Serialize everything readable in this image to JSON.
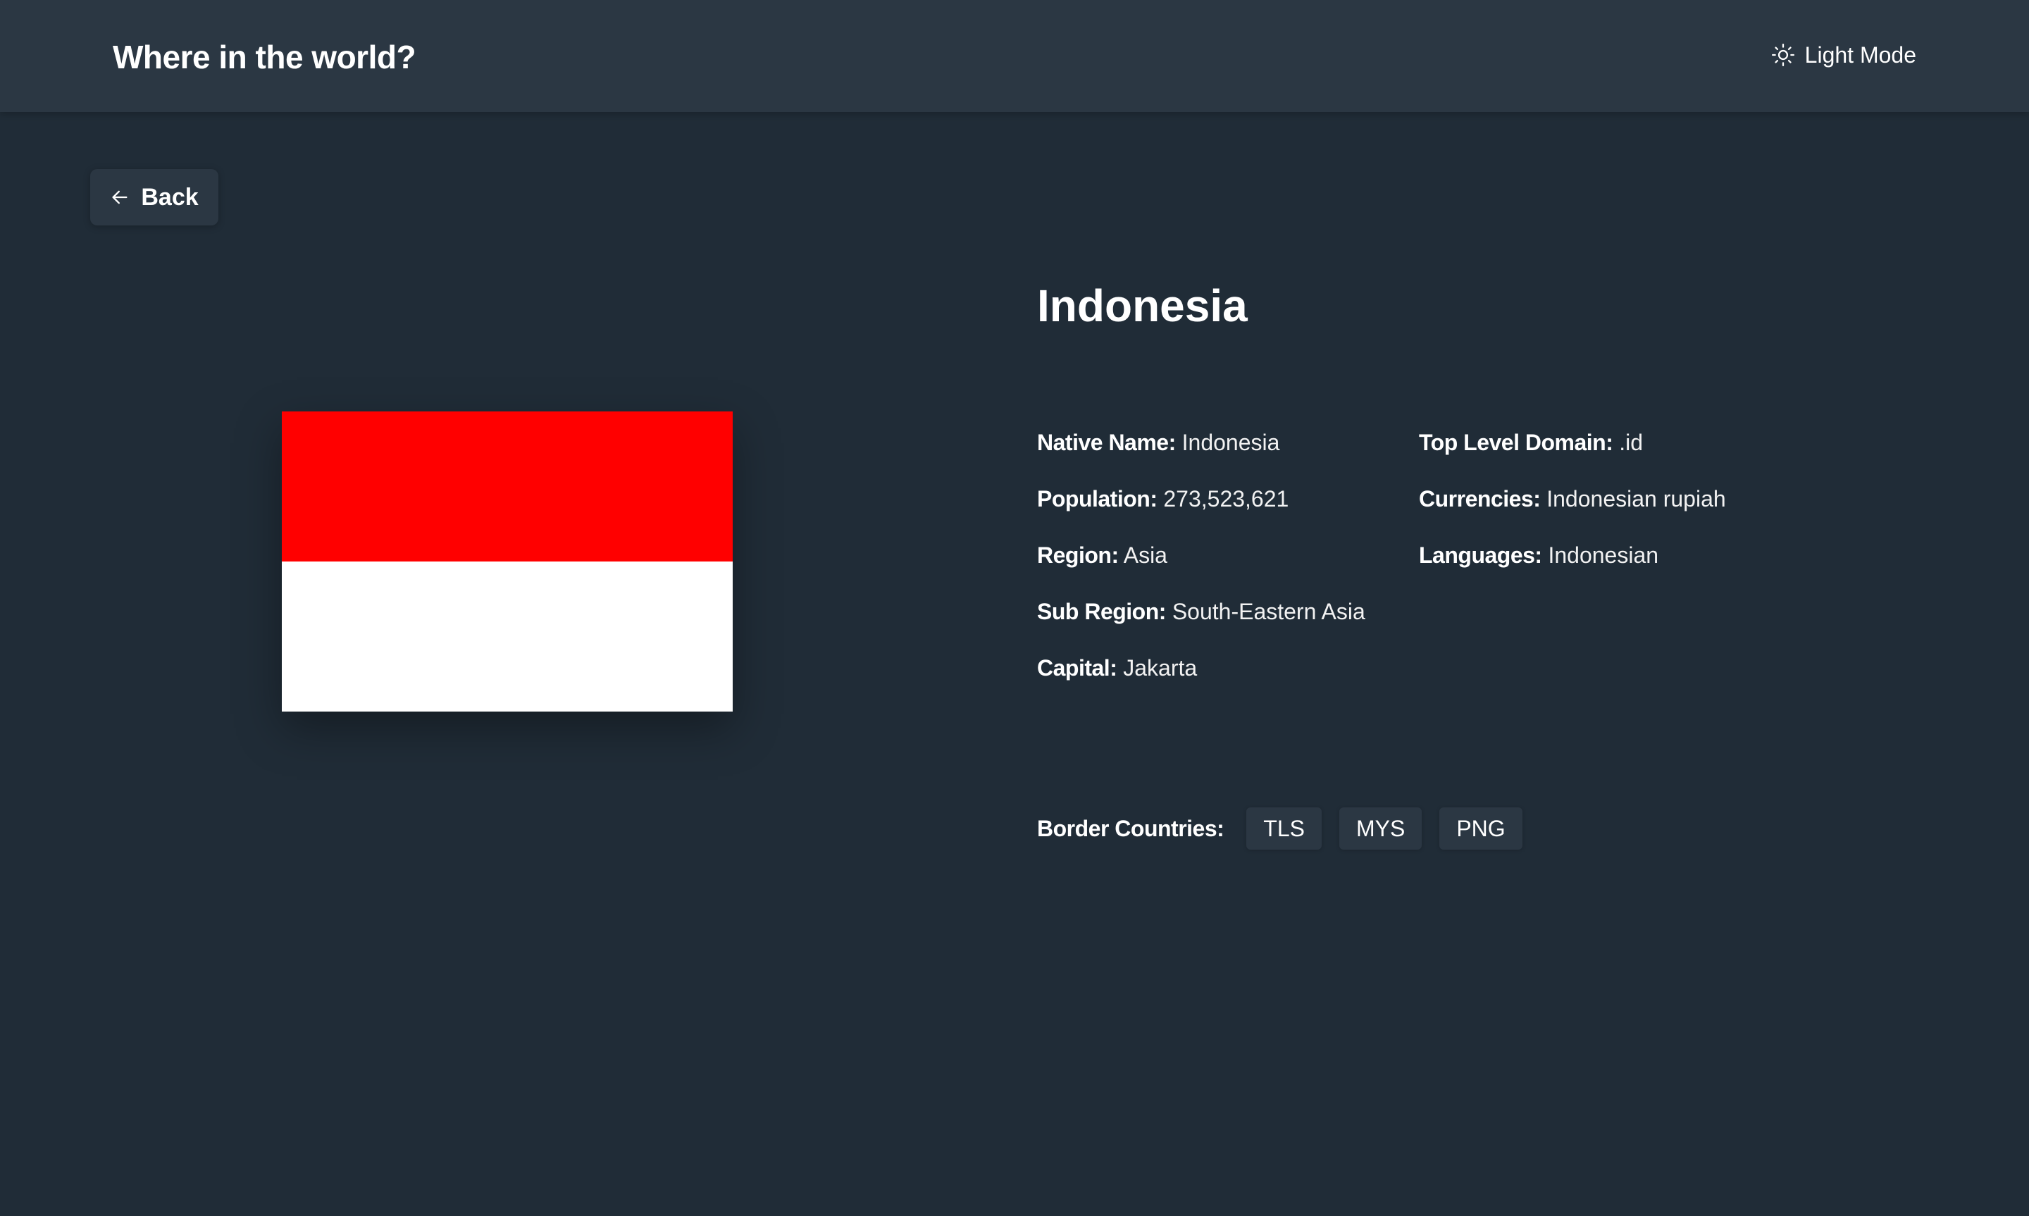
{
  "header": {
    "title": "Where in the world?",
    "theme_toggle_label": "Light Mode",
    "theme_icon": "sun-icon"
  },
  "back_button": {
    "label": "Back",
    "icon": "arrow-left-icon"
  },
  "country": {
    "name": "Indonesia",
    "flag": {
      "alt": "Indonesia",
      "colors": [
        "#ff0000",
        "#ffffff"
      ]
    },
    "details_left": [
      {
        "label": "Native Name:",
        "value": "Indonesia"
      },
      {
        "label": "Population:",
        "value": "273,523,621"
      },
      {
        "label": "Region:",
        "value": "Asia"
      },
      {
        "label": "Sub Region:",
        "value": "South-Eastern Asia"
      },
      {
        "label": "Capital:",
        "value": "Jakarta"
      }
    ],
    "details_right": [
      {
        "label": "Top Level Domain:",
        "value": ".id"
      },
      {
        "label": "Currencies:",
        "value": "Indonesian rupiah"
      },
      {
        "label": "Languages:",
        "value": "Indonesian"
      }
    ],
    "border_label": "Border Countries:",
    "borders": [
      "TLS",
      "MYS",
      "PNG"
    ]
  },
  "theme": {
    "background": "#202c37",
    "element": "#2b3743",
    "text": "#ffffff"
  }
}
